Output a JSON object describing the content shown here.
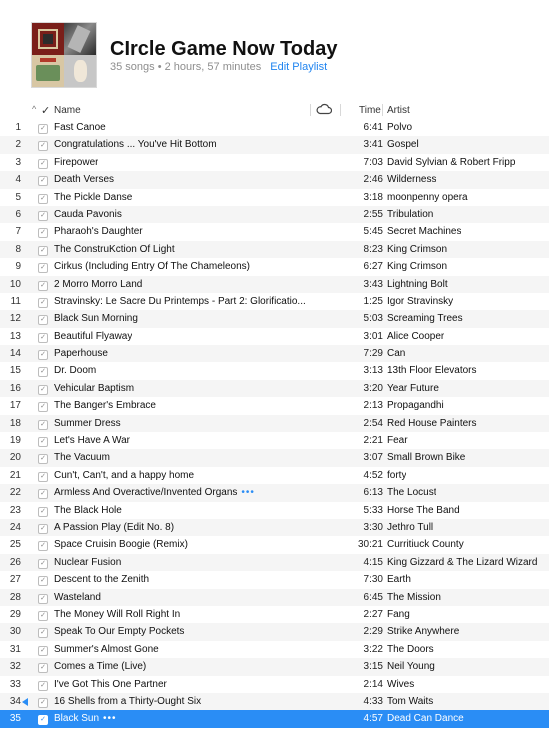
{
  "playlist": {
    "title": "CIrcle Game Now Today",
    "summary": "35 songs • 2 hours, 57 minutes",
    "edit_label": "Edit Playlist",
    "art": [
      "album-art-1",
      "album-art-2",
      "album-art-3",
      "album-art-4"
    ]
  },
  "columns": {
    "sort_indicator": "^",
    "check": "✓",
    "name": "Name",
    "cloud_icon": "cloud-icon",
    "time": "Time",
    "artist": "Artist"
  },
  "colors": {
    "accent": "#2a8df5",
    "selected_row": "#2a8df5"
  },
  "now_playing_row": 34,
  "selected_row": 35,
  "tracks": [
    {
      "num": "1",
      "name": "Fast Canoe",
      "time": "6:41",
      "artist": "Polvo"
    },
    {
      "num": "2",
      "name": "Congratulations ... You've Hit Bottom",
      "time": "3:41",
      "artist": "Gospel"
    },
    {
      "num": "3",
      "name": "Firepower",
      "time": "7:03",
      "artist": "David Sylvian & Robert Fripp"
    },
    {
      "num": "4",
      "name": "Death Verses",
      "time": "2:46",
      "artist": "Wilderness"
    },
    {
      "num": "5",
      "name": "The Pickle Danse",
      "time": "3:18",
      "artist": "moonpenny opera"
    },
    {
      "num": "6",
      "name": "Cauda Pavonis",
      "time": "2:55",
      "artist": "Tribulation"
    },
    {
      "num": "7",
      "name": "Pharaoh's Daughter",
      "time": "5:45",
      "artist": "Secret Machines"
    },
    {
      "num": "8",
      "name": "The ConstruKction Of Light",
      "time": "8:23",
      "artist": "King Crimson"
    },
    {
      "num": "9",
      "name": "Cirkus (Including Entry Of The Chameleons)",
      "time": "6:27",
      "artist": "King Crimson"
    },
    {
      "num": "10",
      "name": "2 Morro Morro Land",
      "time": "3:43",
      "artist": "Lightning Bolt"
    },
    {
      "num": "11",
      "name": "Stravinsky: Le Sacre Du Printemps - Part 2: Glorificatio...",
      "time": "1:25",
      "artist": "Igor Stravinsky"
    },
    {
      "num": "12",
      "name": "Black Sun Morning",
      "time": "5:03",
      "artist": "Screaming Trees"
    },
    {
      "num": "13",
      "name": "Beautiful Flyaway",
      "time": "3:01",
      "artist": "Alice Cooper"
    },
    {
      "num": "14",
      "name": "Paperhouse",
      "time": "7:29",
      "artist": "Can"
    },
    {
      "num": "15",
      "name": "Dr. Doom",
      "time": "3:13",
      "artist": "13th Floor Elevators"
    },
    {
      "num": "16",
      "name": "Vehicular Baptism",
      "time": "3:20",
      "artist": "Year Future"
    },
    {
      "num": "17",
      "name": "The Banger's Embrace",
      "time": "2:13",
      "artist": "Propagandhi"
    },
    {
      "num": "18",
      "name": "Summer Dress",
      "time": "2:54",
      "artist": "Red House Painters"
    },
    {
      "num": "19",
      "name": "Let's Have A War",
      "time": "2:21",
      "artist": "Fear"
    },
    {
      "num": "20",
      "name": "The Vacuum",
      "time": "3:07",
      "artist": "Small Brown Bike"
    },
    {
      "num": "21",
      "name": "Cun't, Can't, and a happy home",
      "time": "4:52",
      "artist": "forty"
    },
    {
      "num": "22",
      "name": "Armless And Overactive/Invented Organs",
      "time": "6:13",
      "artist": "The Locust",
      "more": "•••"
    },
    {
      "num": "23",
      "name": "The Black Hole",
      "time": "5:33",
      "artist": "Horse The Band"
    },
    {
      "num": "24",
      "name": "A Passion Play (Edit No. 8)",
      "time": "3:30",
      "artist": "Jethro Tull"
    },
    {
      "num": "25",
      "name": "Space Cruisin Boogie (Remix)",
      "time": "30:21",
      "artist": "Curritiuck County"
    },
    {
      "num": "26",
      "name": "Nuclear Fusion",
      "time": "4:15",
      "artist": "King Gizzard & The Lizard Wizard"
    },
    {
      "num": "27",
      "name": "Descent to the Zenith",
      "time": "7:30",
      "artist": "Earth"
    },
    {
      "num": "28",
      "name": "Wasteland",
      "time": "6:45",
      "artist": "The Mission"
    },
    {
      "num": "29",
      "name": "The Money Will Roll Right In",
      "time": "2:27",
      "artist": "Fang"
    },
    {
      "num": "30",
      "name": "Speak To Our Empty Pockets",
      "time": "2:29",
      "artist": "Strike Anywhere"
    },
    {
      "num": "31",
      "name": "Summer's Almost Gone",
      "time": "3:22",
      "artist": "The Doors"
    },
    {
      "num": "32",
      "name": "Comes a Time (Live)",
      "time": "3:15",
      "artist": "Neil Young"
    },
    {
      "num": "33",
      "name": "I've Got This One Partner",
      "time": "2:14",
      "artist": "Wives"
    },
    {
      "num": "34",
      "name": "16 Shells from a Thirty-Ought Six",
      "time": "4:33",
      "artist": "Tom Waits"
    },
    {
      "num": "35",
      "name": "Black Sun",
      "time": "4:57",
      "artist": "Dead Can Dance",
      "more": "•••"
    }
  ]
}
